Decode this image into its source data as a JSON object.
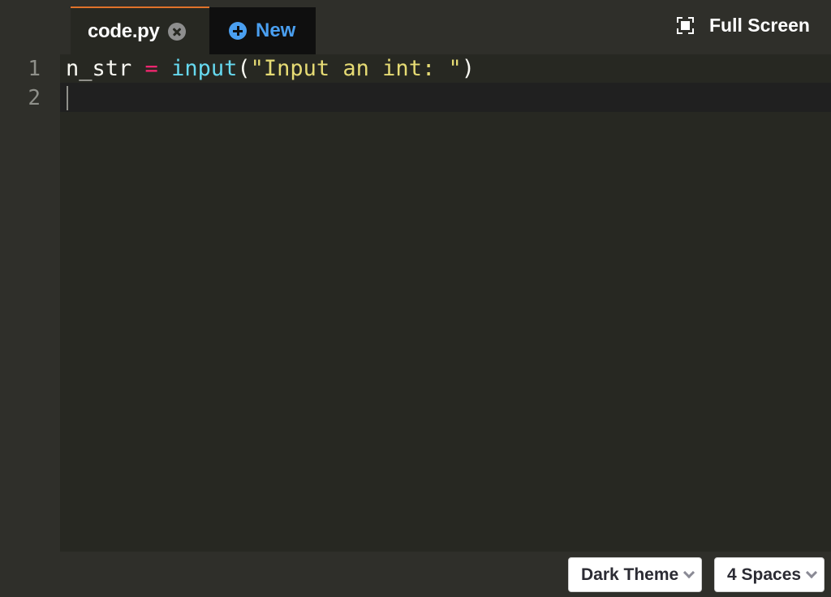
{
  "tabs": {
    "active": {
      "label": "code.py"
    },
    "new_label": "New"
  },
  "header": {
    "fullscreen_label": "Full Screen"
  },
  "editor": {
    "line_numbers": [
      "1",
      "2"
    ],
    "line1": {
      "var": "n_str",
      "op": "=",
      "fn": "input",
      "open": "(",
      "str": "\"Input an int: \"",
      "close": ")"
    }
  },
  "footer": {
    "theme_label": "Dark Theme",
    "indent_label": "4 Spaces"
  },
  "colors": {
    "accent_tab": "#e0722a",
    "new_blue": "#4a9ff0",
    "keyword_pink": "#f92672",
    "function_cyan": "#66d9ef",
    "string_yellow": "#e6db74"
  },
  "icons": [
    "close-icon",
    "plus-circle-icon",
    "fullscreen-icon",
    "chevron-down-icon"
  ]
}
